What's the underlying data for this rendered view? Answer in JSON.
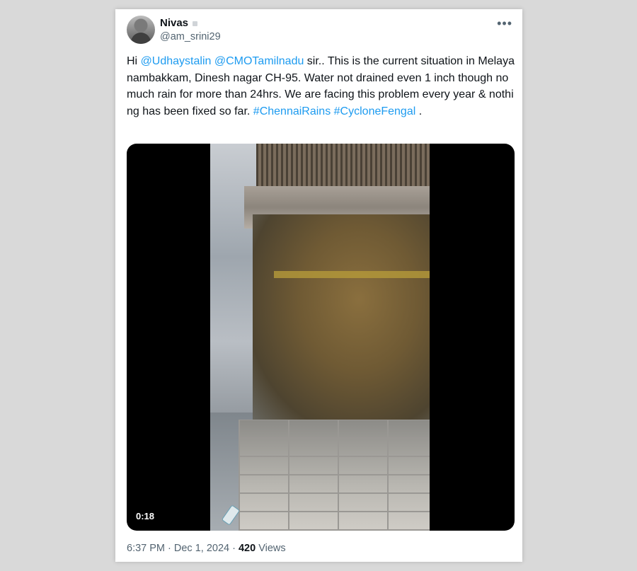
{
  "tweet": {
    "author": {
      "name": "Nivas",
      "handle": "@am_srini29",
      "avatar_icon": "user-avatar"
    },
    "more_icon": "more-horizontal-icon",
    "more_glyph": "•••",
    "text": {
      "greeting": "Hi ",
      "mention1": "@Udhaystalin",
      "space1": " ",
      "mention2": "@CMOTamilnadu",
      "body": " sir.. This is the current situation in Melayanambakkam, Dinesh nagar CH-95. Water not drained even 1 inch though no much rain for more than 24hrs. We are facing this problem every year & nothing has been fixed so far. ",
      "hashtag1": "#ChennaiRains",
      "space2": " ",
      "hashtag2": "#CycloneFengal",
      "trailing": " ."
    },
    "media": {
      "type": "video",
      "duration": "0:18"
    },
    "meta": {
      "time": "6:37 PM",
      "separator1": " · ",
      "date": "Dec 1, 2024",
      "separator2": " · ",
      "views_count": "420",
      "views_label": " Views"
    }
  },
  "colors": {
    "background": "#d9d9d9",
    "card": "#ffffff",
    "link": "#1d9bf0",
    "text": "#0f1419",
    "secondary": "#536471"
  }
}
